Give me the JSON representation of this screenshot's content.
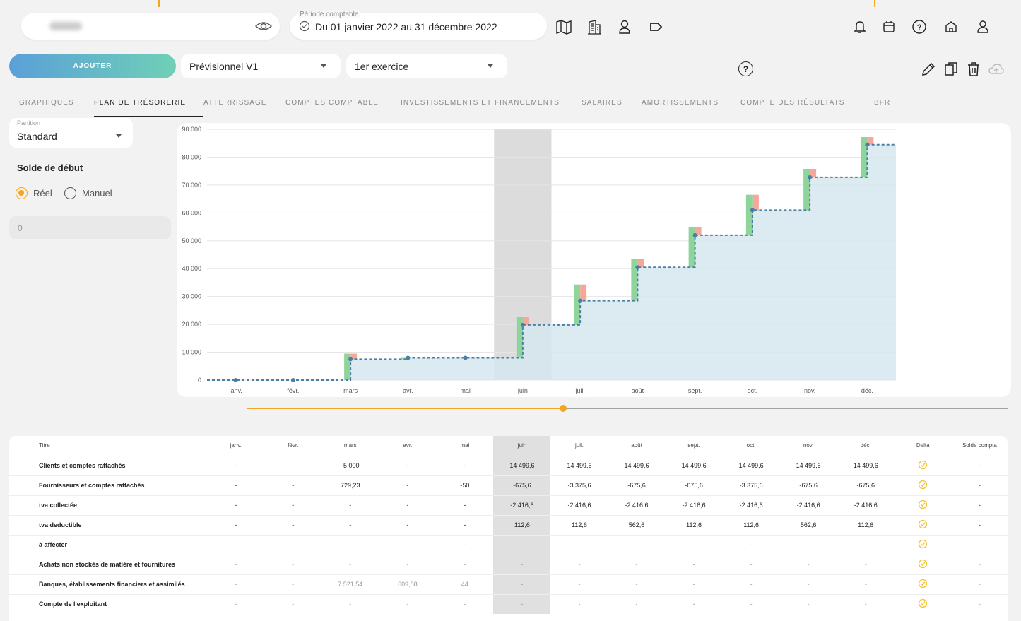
{
  "header": {
    "period_label": "Période comptable",
    "period_value": "Du 01 janvier 2022 au 31 décembre 2022",
    "icons": [
      "map-icon",
      "building-icon",
      "user-switch-icon",
      "tag-icon",
      "bell-icon",
      "calendar-icon",
      "help-icon",
      "home-icon",
      "account-icon"
    ]
  },
  "toolbar": {
    "add_label": "AJOUTER",
    "scenario_value": "Prévisionnel V1",
    "exercise_value": "1er exercice",
    "help_label": "?"
  },
  "tabs": [
    {
      "label": "GRAPHIQUES"
    },
    {
      "label": "PLAN DE TRÉSORERIE"
    },
    {
      "label": "ATTERRISSAGE"
    },
    {
      "label": "COMPTES COMPTABLE"
    },
    {
      "label": "INVESTISSEMENTS ET FINANCEMENTS"
    },
    {
      "label": "SALAIRES"
    },
    {
      "label": "AMORTISSEMENTS"
    },
    {
      "label": "COMPTE DES RÉSULTATS"
    },
    {
      "label": "BFR"
    }
  ],
  "sidebar": {
    "partition_label": "Partition",
    "partition_value": "Standard",
    "solde_title": "Solde de début",
    "radio_real": "Réel",
    "radio_manual": "Manuel",
    "solde_value": "0"
  },
  "chart_data": {
    "type": "line",
    "categories": [
      "janv.",
      "févr.",
      "mars",
      "avr.",
      "mai",
      "juin",
      "juil.",
      "août",
      "sept.",
      "oct.",
      "nov.",
      "déc."
    ],
    "series": [
      {
        "values": [
          0,
          0,
          7500,
          8000,
          8000,
          19800,
          28500,
          40500,
          52000,
          61000,
          72800,
          84500
        ]
      }
    ],
    "inflows": [
      0,
      0,
      9500,
      8000,
      8000,
      22800,
      34300,
      43500,
      54900,
      66500,
      75800,
      87200
    ],
    "outflows_top": [
      0,
      0,
      9500,
      8000,
      8000,
      22800,
      34300,
      43500,
      54900,
      66500,
      75800,
      87200
    ],
    "yticks": [
      "90 000",
      "80 000",
      "70 000",
      "60 000",
      "50 000",
      "40 000",
      "30 000",
      "20 000",
      "10 000",
      "0"
    ],
    "ylim": [
      0,
      90000
    ],
    "highlight_category": "juin",
    "colors": {
      "balance": "#4a7fa5",
      "area": "#d6e6ef",
      "inflow": "#8fd49a",
      "outflow": "#f5a89a",
      "highlight": "#dcdcdc"
    }
  },
  "table": {
    "headers": [
      "Titre",
      "janv.",
      "févr.",
      "mars",
      "avr.",
      "mai",
      "juin",
      "juil.",
      "août",
      "sept.",
      "oct.",
      "nov.",
      "déc.",
      "Delta",
      "Solde compta"
    ],
    "rows": [
      {
        "title": "Clients et comptes rattachés",
        "cells": [
          "-",
          "-",
          "-5 000",
          "-",
          "-",
          "14 499,6",
          "14 499,6",
          "14 499,6",
          "14 499,6",
          "14 499,6",
          "14 499,6",
          "14 499,6"
        ],
        "solde": "-"
      },
      {
        "title": "Fournisseurs et comptes rattachés",
        "cells": [
          "-",
          "-",
          "729,23",
          "-",
          "-50",
          "-675,6",
          "-3 375,6",
          "-675,6",
          "-675,6",
          "-3 375,6",
          "-675,6",
          "-675,6"
        ],
        "solde": "-"
      },
      {
        "title": "tva collectée",
        "cells": [
          "-",
          "-",
          "-",
          "-",
          "-",
          "-2 416,6",
          "-2 416,6",
          "-2 416,6",
          "-2 416,6",
          "-2 416,6",
          "-2 416,6",
          "-2 416,6"
        ],
        "solde": "-"
      },
      {
        "title": "tva deductible",
        "cells": [
          "-",
          "-",
          "-",
          "-",
          "-",
          "112,6",
          "112,6",
          "562,6",
          "112,6",
          "112,6",
          "562,6",
          "112,6"
        ],
        "solde": "-"
      },
      {
        "title": "à affecter",
        "cells": [
          "-",
          "-",
          "-",
          "-",
          "-",
          "-",
          "-",
          "-",
          "-",
          "-",
          "-",
          "-"
        ],
        "solde": "-"
      },
      {
        "title": "Achats non stockés de matière et fournitures",
        "cells": [
          "-",
          "-",
          "-",
          "-",
          "-",
          "-",
          "-",
          "-",
          "-",
          "-",
          "-",
          "-"
        ],
        "solde": "-"
      },
      {
        "title": "Banques, établissements financiers et assimilés",
        "cells": [
          "-",
          "-",
          "7 521,54",
          "609,88",
          "44",
          "-",
          "-",
          "-",
          "-",
          "-",
          "-",
          "-"
        ],
        "solde": "-"
      },
      {
        "title": "Compte de l'exploitant",
        "cells": [
          "-",
          "-",
          "-",
          "-",
          "-",
          "-",
          "-",
          "-",
          "-",
          "-",
          "-",
          "-"
        ],
        "solde": "-"
      }
    ]
  }
}
